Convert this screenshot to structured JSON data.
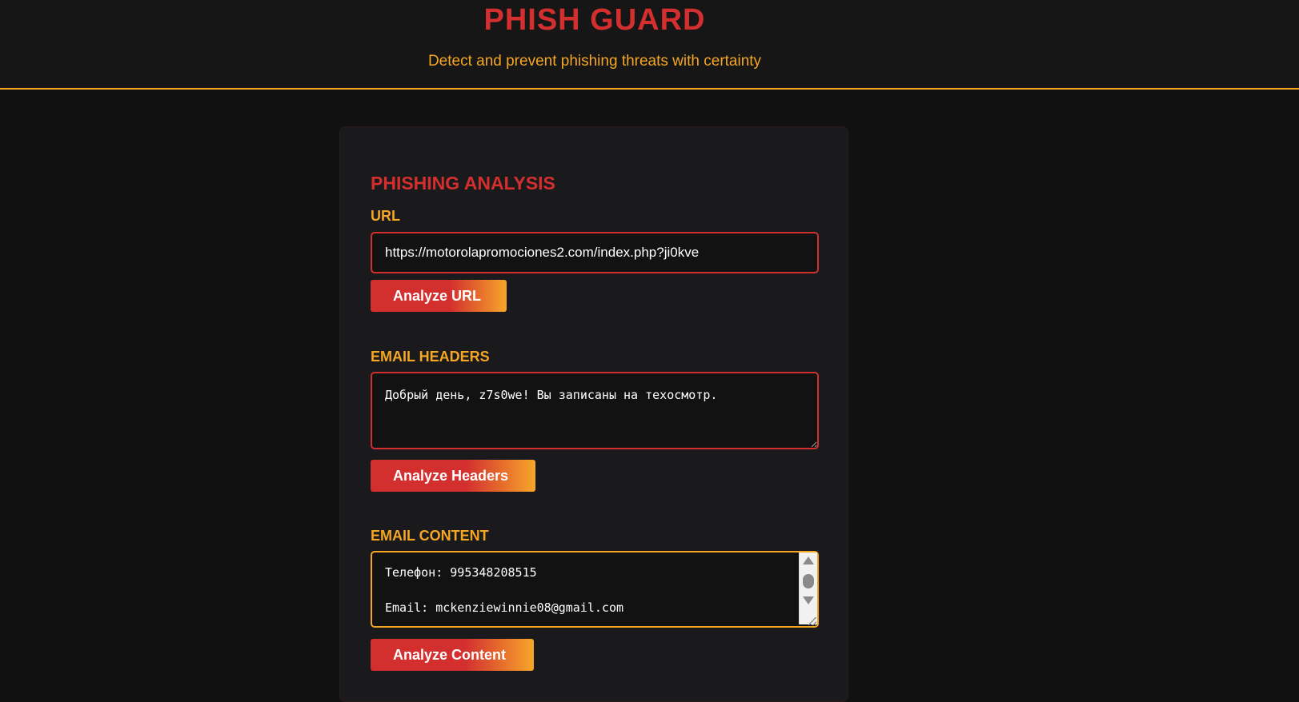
{
  "header": {
    "title": "PHISH GUARD",
    "tagline": "Detect and prevent phishing threats with certainty"
  },
  "analysis": {
    "section_title": "PHISHING ANALYSIS",
    "url": {
      "label": "URL",
      "value": "https://motorolapromociones2.com/index.php?ji0kve",
      "button_label": "Analyze URL"
    },
    "headers": {
      "label": "EMAIL HEADERS",
      "value": "Добрый день, z7s0we! Вы записаны на техосмотр.",
      "button_label": "Analyze Headers"
    },
    "content": {
      "label": "EMAIL CONTENT",
      "value": "Телефон: 995348208515\n\nEmail: mckenziewinnie08@gmail.com",
      "button_label": "Analyze Content"
    }
  },
  "colors": {
    "accent_red": "#d32f2f",
    "accent_amber": "#f5a623",
    "background": "#111112",
    "card": "#1a1a1c"
  },
  "icons": {
    "scroll_up": "triangle-up-icon",
    "scroll_down": "triangle-down-icon",
    "resize": "resize-grip-icon"
  }
}
